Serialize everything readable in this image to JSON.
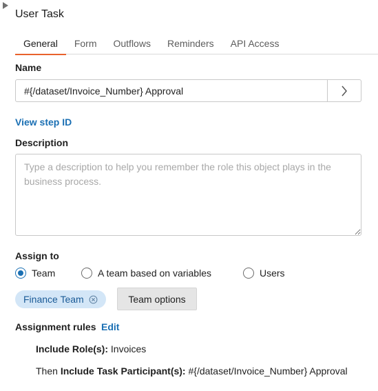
{
  "panel": {
    "title": "User Task"
  },
  "tabs": [
    {
      "label": "General",
      "active": true
    },
    {
      "label": "Form",
      "active": false
    },
    {
      "label": "Outflows",
      "active": false
    },
    {
      "label": "Reminders",
      "active": false
    },
    {
      "label": "API Access",
      "active": false
    }
  ],
  "name": {
    "label": "Name",
    "value": "#{/dataset/Invoice_Number} Approval"
  },
  "view_step_id": "View step ID",
  "description": {
    "label": "Description",
    "value": "",
    "placeholder": "Type a description to help you remember the role this object plays in the business process."
  },
  "assign_to": {
    "label": "Assign to",
    "options": [
      {
        "label": "Team",
        "selected": true
      },
      {
        "label": "A team based on variables",
        "selected": false
      },
      {
        "label": "Users",
        "selected": false
      }
    ],
    "selected_team": "Finance Team",
    "team_options_label": "Team options"
  },
  "assignment_rules": {
    "label": "Assignment rules",
    "edit_label": "Edit",
    "rule1": {
      "key": "Include Role(s):",
      "value": " Invoices"
    },
    "rule2": {
      "prefix": "Then ",
      "key": "Include Task Participant(s):",
      "value": " #{/dataset/Invoice_Number} Approval"
    }
  },
  "colors": {
    "accent": "#e8612c",
    "link": "#1a6fb3",
    "chip_bg": "#d3e6f7"
  }
}
